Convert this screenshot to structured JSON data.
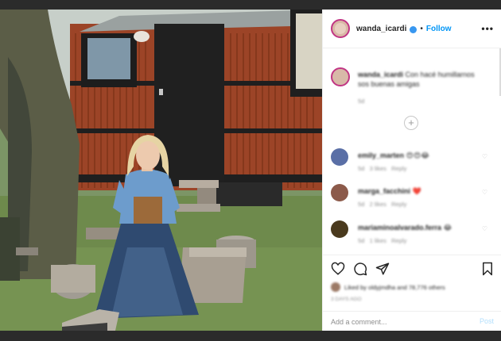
{
  "post": {
    "username": "wanda_icardi",
    "follow_label": "Follow",
    "separator": "•",
    "more_label": "•••"
  },
  "caption": {
    "username": "wanda_icardi",
    "text": "Con hacé humillarnos sos buenas amigas",
    "time": "5d"
  },
  "comments": [
    {
      "username": "emily_marten",
      "text": "😍😍😂",
      "time": "5d",
      "likes": "3 likes",
      "reply": "Reply",
      "avatar_color": "#5a6fa6"
    },
    {
      "username": "marga_facchini",
      "text": "❤️",
      "time": "5d",
      "likes": "2 likes",
      "reply": "Reply",
      "avatar_color": "#8c5a4a"
    },
    {
      "username": "mariaminoalvarado.ferra",
      "text": "😂",
      "time": "5d",
      "likes": "1 likes",
      "reply": "Reply",
      "avatar_color": "#4a3a1e"
    }
  ],
  "load_more_label": "+",
  "likes_text": "Liked by oldyjmdha and 78,776 others",
  "timestamp": "3 DAYS AGO",
  "add_comment_placeholder": "Add a comment...",
  "post_label": "Post",
  "colors": {
    "accent": "#0095f6",
    "story_ring": "#c13584"
  }
}
